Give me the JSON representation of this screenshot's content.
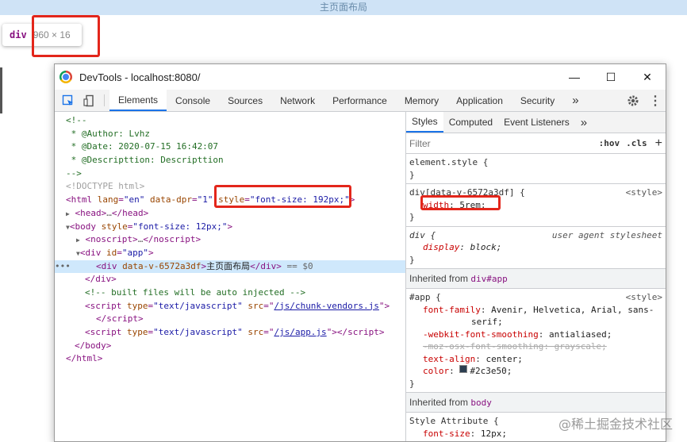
{
  "page": {
    "top_bar_text": "主页面布局",
    "tooltip": {
      "tag": "div",
      "dims": "960 × 16"
    },
    "watermark": "@稀土掘金技术社区"
  },
  "window": {
    "title": "DevTools - localhost:8080/",
    "controls": {
      "minimize": "—",
      "maximize": "☐",
      "close": "✕"
    }
  },
  "toolbar": {
    "tabs": [
      "Elements",
      "Console",
      "Sources",
      "Network",
      "Performance",
      "Memory",
      "Application",
      "Security"
    ],
    "active_tab": "Elements",
    "more": "»",
    "settings_icon": "gear-icon",
    "kebab": "⋮"
  },
  "elements_panel": {
    "lines": [
      "<!--",
      " * @Author: Lvhz",
      " * @Date: 2020-07-15 16:42:07",
      " * @Descripttion: Descripttion",
      "-->",
      "<!DOCTYPE html>",
      "html lang=\"en\" data-dpr=\"1\" style=\"font-size: 192px;\"",
      "head…/head",
      "body style=\"font-size: 12px;\"",
      "noscript…/noscript",
      "div id=\"app\"",
      "div data-v-6572a3df 主页面布局 /div == $0",
      "/div",
      "<!-- built files will be auto injected -->",
      "script type=\"text/javascript\" src=\"/js/chunk-vendors.js\" /script",
      "script type=\"text/javascript\" src=\"/js/app.js\" /script",
      "/body",
      "/html"
    ],
    "comment": {
      "open": "<!--",
      "author": " * @Author: Lvhz",
      "date": " * @Date: 2020-07-15 16:42:07",
      "desc": " * @Descripttion: Descripttion",
      "close": "-->"
    },
    "doctype": "<!DOCTYPE html>",
    "html_attrs": {
      "lang": "\"en\"",
      "dpr": "\"1\"",
      "style": "\"font-size: 192px;\""
    },
    "body_style": "\"font-size: 12px;\"",
    "app_id": "\"app\"",
    "selected_text": "主页面布局",
    "selected_suffix": " == $0",
    "built_comment": "<!-- built files will be auto injected -->",
    "script1_src": "/js/chunk-vendors.js",
    "script2_src": "/js/app.js",
    "script_type": "\"text/javascript\"",
    "data_attr": "data-v-6572a3df",
    "ellipsis": "…"
  },
  "styles_panel": {
    "tabs": [
      "Styles",
      "Computed",
      "Event Listeners"
    ],
    "active_tab": "Styles",
    "more": "»",
    "filter_placeholder": "Filter",
    "hov": ":hov",
    "cls": ".cls",
    "plus": "+",
    "element_style": "element.style {",
    "rule1": {
      "selector": "div[data-v-6572a3df] {",
      "source": "<style>",
      "prop": "width",
      "value": "5rem;"
    },
    "rule2": {
      "selector": "div {",
      "source": "user agent stylesheet",
      "prop": "display",
      "value": "block;"
    },
    "inherited_app": {
      "label": "Inherited from ",
      "selector": "div#app"
    },
    "rule3": {
      "selector": "#app {",
      "source": "<style>",
      "props": [
        {
          "name": "font-family",
          "value": "Avenir, Helvetica, Arial, sans-"
        },
        {
          "name": "",
          "value": "serif;"
        },
        {
          "name": "-webkit-font-smoothing",
          "value": "antialiased;"
        },
        {
          "name": "-moz-osx-font-smoothing",
          "value": "grayscale;"
        },
        {
          "name": "text-align",
          "value": "center;"
        },
        {
          "name": "color",
          "value": "#2c3e50;"
        }
      ]
    },
    "inherited_body": {
      "label": "Inherited from ",
      "selector": "body"
    },
    "rule4": {
      "selector": "Style Attribute {",
      "prop": "font-size",
      "value": "12px;"
    },
    "close_brace": "}"
  },
  "colors": {
    "highlight": "#e3261b",
    "selected_row": "#cfe8fc",
    "accent": "#1a73e8",
    "app_color": "#2c3e50"
  }
}
